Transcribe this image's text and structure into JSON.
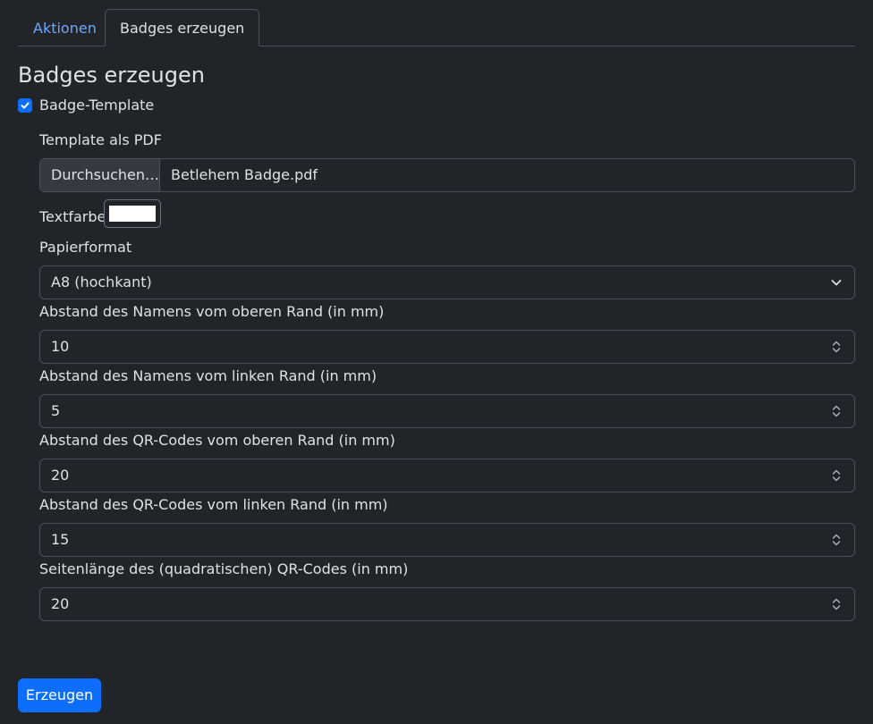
{
  "tabs": [
    {
      "label": "Aktionen",
      "active": false
    },
    {
      "label": "Badges erzeugen",
      "active": true
    }
  ],
  "heading": "Badges erzeugen",
  "badge_template": {
    "label": "Badge-Template",
    "checked": true
  },
  "template_pdf": {
    "label": "Template als PDF",
    "button_label": "Durchsuchen…",
    "file_name": "Betlehem Badge.pdf"
  },
  "text_color": {
    "label": "Textfarbe",
    "value": "#ffffff"
  },
  "paper_format": {
    "label": "Papierformat",
    "selected": "A8 (hochkant)"
  },
  "fields": [
    {
      "label": "Abstand des Namens vom oberen Rand (in mm)",
      "value": "10"
    },
    {
      "label": "Abstand des Namens vom linken Rand (in mm)",
      "value": "5"
    },
    {
      "label": "Abstand des QR-Codes vom oberen Rand (in mm)",
      "value": "20"
    },
    {
      "label": "Abstand des QR-Codes vom linken Rand (in mm)",
      "value": "15"
    },
    {
      "label": "Seitenlänge des (quadratischen) QR-Codes (in mm)",
      "value": "20"
    }
  ],
  "submit_label": "Erzeugen",
  "colors": {
    "accent": "#0d6efd",
    "link": "#6ea8fe",
    "background": "#212529"
  }
}
